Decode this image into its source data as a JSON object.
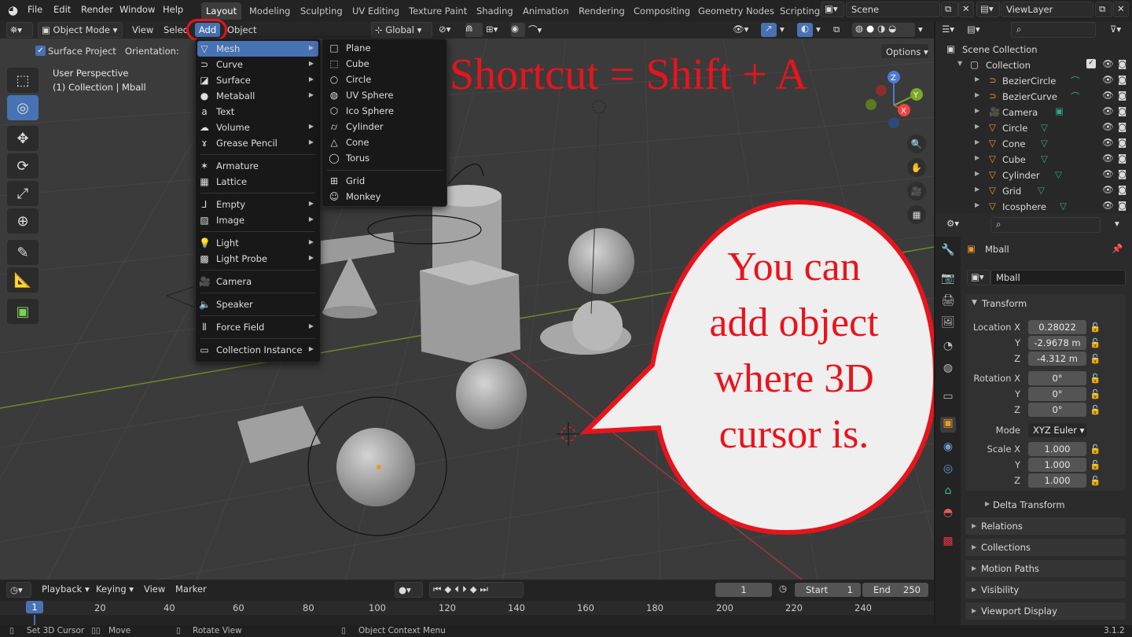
{
  "topbar": {
    "menus": [
      "File",
      "Edit",
      "Render",
      "Window",
      "Help"
    ],
    "workspaces": [
      "Layout",
      "Modeling",
      "Sculpting",
      "UV Editing",
      "Texture Paint",
      "Shading",
      "Animation",
      "Rendering",
      "Compositing",
      "Geometry Nodes",
      "Scripting"
    ],
    "scene": "Scene",
    "view_layer": "ViewLayer"
  },
  "viewport_header": {
    "mode": "Object Mode",
    "menus": [
      "View",
      "Select",
      "Add",
      "Object"
    ],
    "transform_orientation": "Global",
    "options_label": "Options",
    "surface_project": "Surface Project",
    "orientation_label": "Orientation:"
  },
  "viewport_info": {
    "line1": "User Perspective",
    "line2": "(1) Collection | Mball"
  },
  "add_menu": {
    "items": [
      {
        "label": "Mesh",
        "icon": "mesh-icon",
        "submenu": true
      },
      {
        "label": "Curve",
        "icon": "curve-icon",
        "submenu": true
      },
      {
        "label": "Surface",
        "icon": "surface-icon",
        "submenu": true
      },
      {
        "label": "Metaball",
        "icon": "metaball-icon",
        "submenu": true
      },
      {
        "label": "Text",
        "icon": "text-icon",
        "submenu": false
      },
      {
        "label": "Volume",
        "icon": "volume-icon",
        "submenu": true
      },
      {
        "label": "Grease Pencil",
        "icon": "grease-pencil-icon",
        "submenu": true
      },
      {
        "label": "Armature",
        "icon": "armature-icon",
        "submenu": false
      },
      {
        "label": "Lattice",
        "icon": "lattice-icon",
        "submenu": false
      },
      {
        "label": "Empty",
        "icon": "empty-icon",
        "submenu": true
      },
      {
        "label": "Image",
        "icon": "image-icon",
        "submenu": true
      },
      {
        "label": "Light",
        "icon": "light-icon",
        "submenu": true
      },
      {
        "label": "Light Probe",
        "icon": "light-probe-icon",
        "submenu": true
      },
      {
        "label": "Camera",
        "icon": "camera-icon",
        "submenu": false
      },
      {
        "label": "Speaker",
        "icon": "speaker-icon",
        "submenu": false
      },
      {
        "label": "Force Field",
        "icon": "force-field-icon",
        "submenu": true
      },
      {
        "label": "Collection Instance",
        "icon": "collection-instance-icon",
        "submenu": true
      }
    ]
  },
  "mesh_menu": {
    "items": [
      "Plane",
      "Cube",
      "Circle",
      "UV Sphere",
      "Ico Sphere",
      "Cylinder",
      "Cone",
      "Torus",
      "Grid",
      "Monkey"
    ]
  },
  "annotations": {
    "shortcut": "Shortcut = Shift + A",
    "bubble_lines": [
      "You can",
      "add object",
      "where 3D",
      "cursor is."
    ],
    "accent": "#e8141c"
  },
  "outliner": {
    "scene_collection": "Scene Collection",
    "collection": "Collection",
    "objects": [
      "BezierCircle",
      "BezierCurve",
      "Camera",
      "Circle",
      "Cone",
      "Cube",
      "Cylinder",
      "Grid",
      "Icosphere"
    ]
  },
  "properties": {
    "object_name": "Mball",
    "data_name": "Mball",
    "transform_title": "Transform",
    "location": {
      "label": "Location X",
      "x": "0.28022",
      "y": "-2.9678 m",
      "z": "-4.312 m"
    },
    "rotation": {
      "label": "Rotation X",
      "x": "0°",
      "y": "0°",
      "z": "0°"
    },
    "mode_label": "Mode",
    "mode_value": "XYZ Euler",
    "scale": {
      "label": "Scale X",
      "x": "1.000",
      "y": "1.000",
      "z": "1.000"
    },
    "axis_y": "Y",
    "axis_z": "Z",
    "sections": [
      "Delta Transform",
      "Relations",
      "Collections",
      "Motion Paths",
      "Visibility",
      "Viewport Display"
    ]
  },
  "timeline": {
    "menus": [
      "Playback",
      "Keying",
      "View",
      "Marker"
    ],
    "current_frame": "1",
    "start_label": "Start",
    "start": "1",
    "end_label": "End",
    "end": "250",
    "ruler": [
      "1",
      "20",
      "40",
      "60",
      "80",
      "100",
      "120",
      "140",
      "160",
      "180",
      "200",
      "220",
      "240"
    ]
  },
  "statusbar": {
    "items": [
      "Set 3D Cursor",
      "Move",
      "Rotate View",
      "Object Context Menu"
    ],
    "version": "3.1.2"
  }
}
